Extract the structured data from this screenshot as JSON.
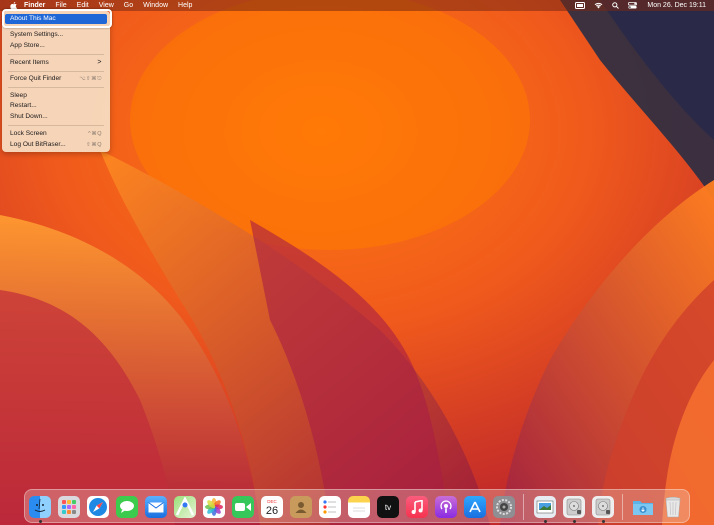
{
  "menubar": {
    "app": "Finder",
    "items": [
      "File",
      "Edit",
      "View",
      "Go",
      "Window",
      "Help"
    ],
    "clock": "Mon 26. Dec  19:11",
    "status_icons": [
      "screen-mirror-icon",
      "wifi-icon",
      "spotlight-search-icon",
      "control-center-icon"
    ]
  },
  "apple_menu": {
    "items": [
      {
        "label": "About This Mac"
      },
      {
        "label": "System Settings..."
      },
      {
        "label": "App Store..."
      },
      {
        "label": "Recent Items",
        "submenu": ">"
      },
      {
        "label": "Force Quit Finder",
        "shortcut": "⌥⇧⌘⎋"
      },
      {
        "label": "Sleep"
      },
      {
        "label": "Restart..."
      },
      {
        "label": "Shut Down..."
      },
      {
        "label": "Lock Screen",
        "shortcut": "^⌘Q"
      },
      {
        "label": "Log Out BitRaser...",
        "shortcut": "⇧⌘Q"
      }
    ]
  },
  "dock": {
    "calendar_month": "DEC",
    "calendar_day": "26",
    "apps": [
      "finder-icon",
      "launchpad-icon",
      "safari-icon",
      "messages-icon",
      "mail-icon",
      "maps-icon",
      "photos-icon",
      "facetime-icon",
      "calendar-icon",
      "contacts-icon",
      "reminders-icon",
      "notes-icon",
      "apple-tv-icon",
      "music-icon",
      "podcasts-icon",
      "app-store-icon",
      "system-settings-icon",
      "preview-icon",
      "disk-utility-icon",
      "disk-utility-2-icon",
      "downloads-folder-icon",
      "trash-icon"
    ],
    "tv_label": "tv"
  }
}
